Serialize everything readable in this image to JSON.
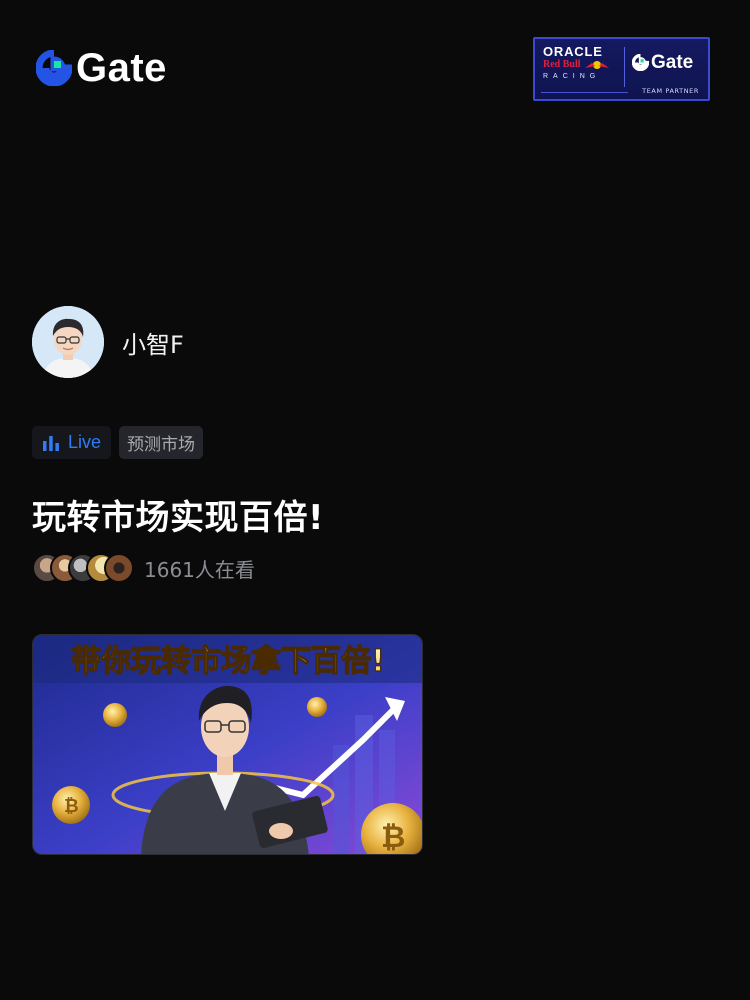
{
  "brand": {
    "name": "Gate",
    "accent": "#2354e6",
    "accent_teal": "#17e6a1"
  },
  "partner_badge": {
    "line1": "ORACLE",
    "line2": "Red Bull",
    "line3": "RACING",
    "brand": "Gate",
    "caption": "TEAM PARTNER"
  },
  "host": {
    "name": "小智F",
    "avatar_icon": "user-avatar"
  },
  "tags": {
    "live": "Live",
    "category": "预测市场",
    "live_color": "#2e7cf6"
  },
  "stream": {
    "title": "玩转市场实现百倍!",
    "viewers": "1661人在看",
    "cover_headline": "带你玩转市场拿下百倍!"
  }
}
